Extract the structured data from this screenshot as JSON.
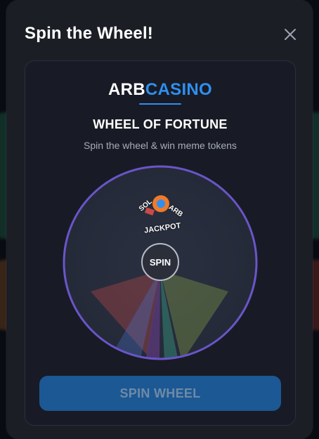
{
  "modal": {
    "title": "Spin the Wheel!",
    "close_icon": "close-icon"
  },
  "brand": {
    "part1": "ARB",
    "part2": "CASINO",
    "accent_color": "#2f8ff0"
  },
  "wheel": {
    "heading": "WHEEL OF FORTUNE",
    "subheading": "Spin the wheel & win meme tokens",
    "center_label": "SPIN",
    "prize_labels": [
      "JACKPOT",
      "SOL",
      "ARB"
    ],
    "segment_colors": [
      "#c94a4a",
      "#3aa889",
      "#8fa84a",
      "#4a6fc9",
      "#9b4ac9"
    ],
    "rim_color": "#6a55c9"
  },
  "spin_button": {
    "label": "SPIN WHEEL"
  }
}
